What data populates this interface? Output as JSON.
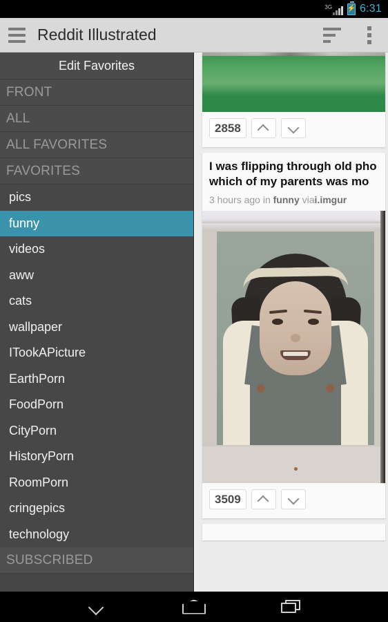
{
  "status_bar": {
    "network_label": "3G",
    "battery_icon": "battery-charging-icon",
    "signal_icon": "signal-bars-icon",
    "time": "6:31"
  },
  "app_bar": {
    "menu_icon": "hamburger-menu-icon",
    "title": "Reddit Illustrated",
    "sort_icon": "sort-icon",
    "overflow_icon": "overflow-menu-icon"
  },
  "sidebar": {
    "header": "Edit Favorites",
    "sections": [
      {
        "label": "FRONT",
        "type": "section"
      },
      {
        "label": "ALL",
        "type": "section"
      },
      {
        "label": "ALL FAVORITES",
        "type": "section"
      },
      {
        "label": "FAVORITES",
        "type": "section"
      }
    ],
    "items": [
      {
        "label": "pics",
        "selected": false
      },
      {
        "label": "funny",
        "selected": true
      },
      {
        "label": "videos",
        "selected": false
      },
      {
        "label": "aww",
        "selected": false
      },
      {
        "label": "cats",
        "selected": false
      },
      {
        "label": "wallpaper",
        "selected": false
      },
      {
        "label": "ITookAPicture",
        "selected": false
      },
      {
        "label": "EarthPorn",
        "selected": false
      },
      {
        "label": "FoodPorn",
        "selected": false
      },
      {
        "label": "CityPorn",
        "selected": false
      },
      {
        "label": "HistoryPorn",
        "selected": false
      },
      {
        "label": "RoomPorn",
        "selected": false
      },
      {
        "label": "cringepics",
        "selected": false
      },
      {
        "label": "technology",
        "selected": false
      }
    ],
    "footer_section": "SUBSCRIBED",
    "selected_color": "#3a92ab",
    "background_color": "#454545"
  },
  "content": {
    "posts": [
      {
        "image": "green-field-photo",
        "score": "2858",
        "upvote_icon": "chevron-up-icon",
        "downvote_icon": "chevron-down-icon"
      },
      {
        "title_line_1": "I was flipping through old pho",
        "title_line_2": "which of my parents was mo",
        "meta_time": "3 hours ago",
        "meta_in": "in",
        "meta_subreddit": "funny",
        "meta_via": "via",
        "meta_domain": "i.imgur",
        "image": "vintage-school-portrait-photo",
        "score": "3509",
        "upvote_icon": "chevron-up-icon",
        "downvote_icon": "chevron-down-icon"
      }
    ]
  },
  "nav_bar": {
    "back_icon": "back-chevron-icon",
    "home_icon": "home-icon",
    "recents_icon": "recents-icon"
  }
}
